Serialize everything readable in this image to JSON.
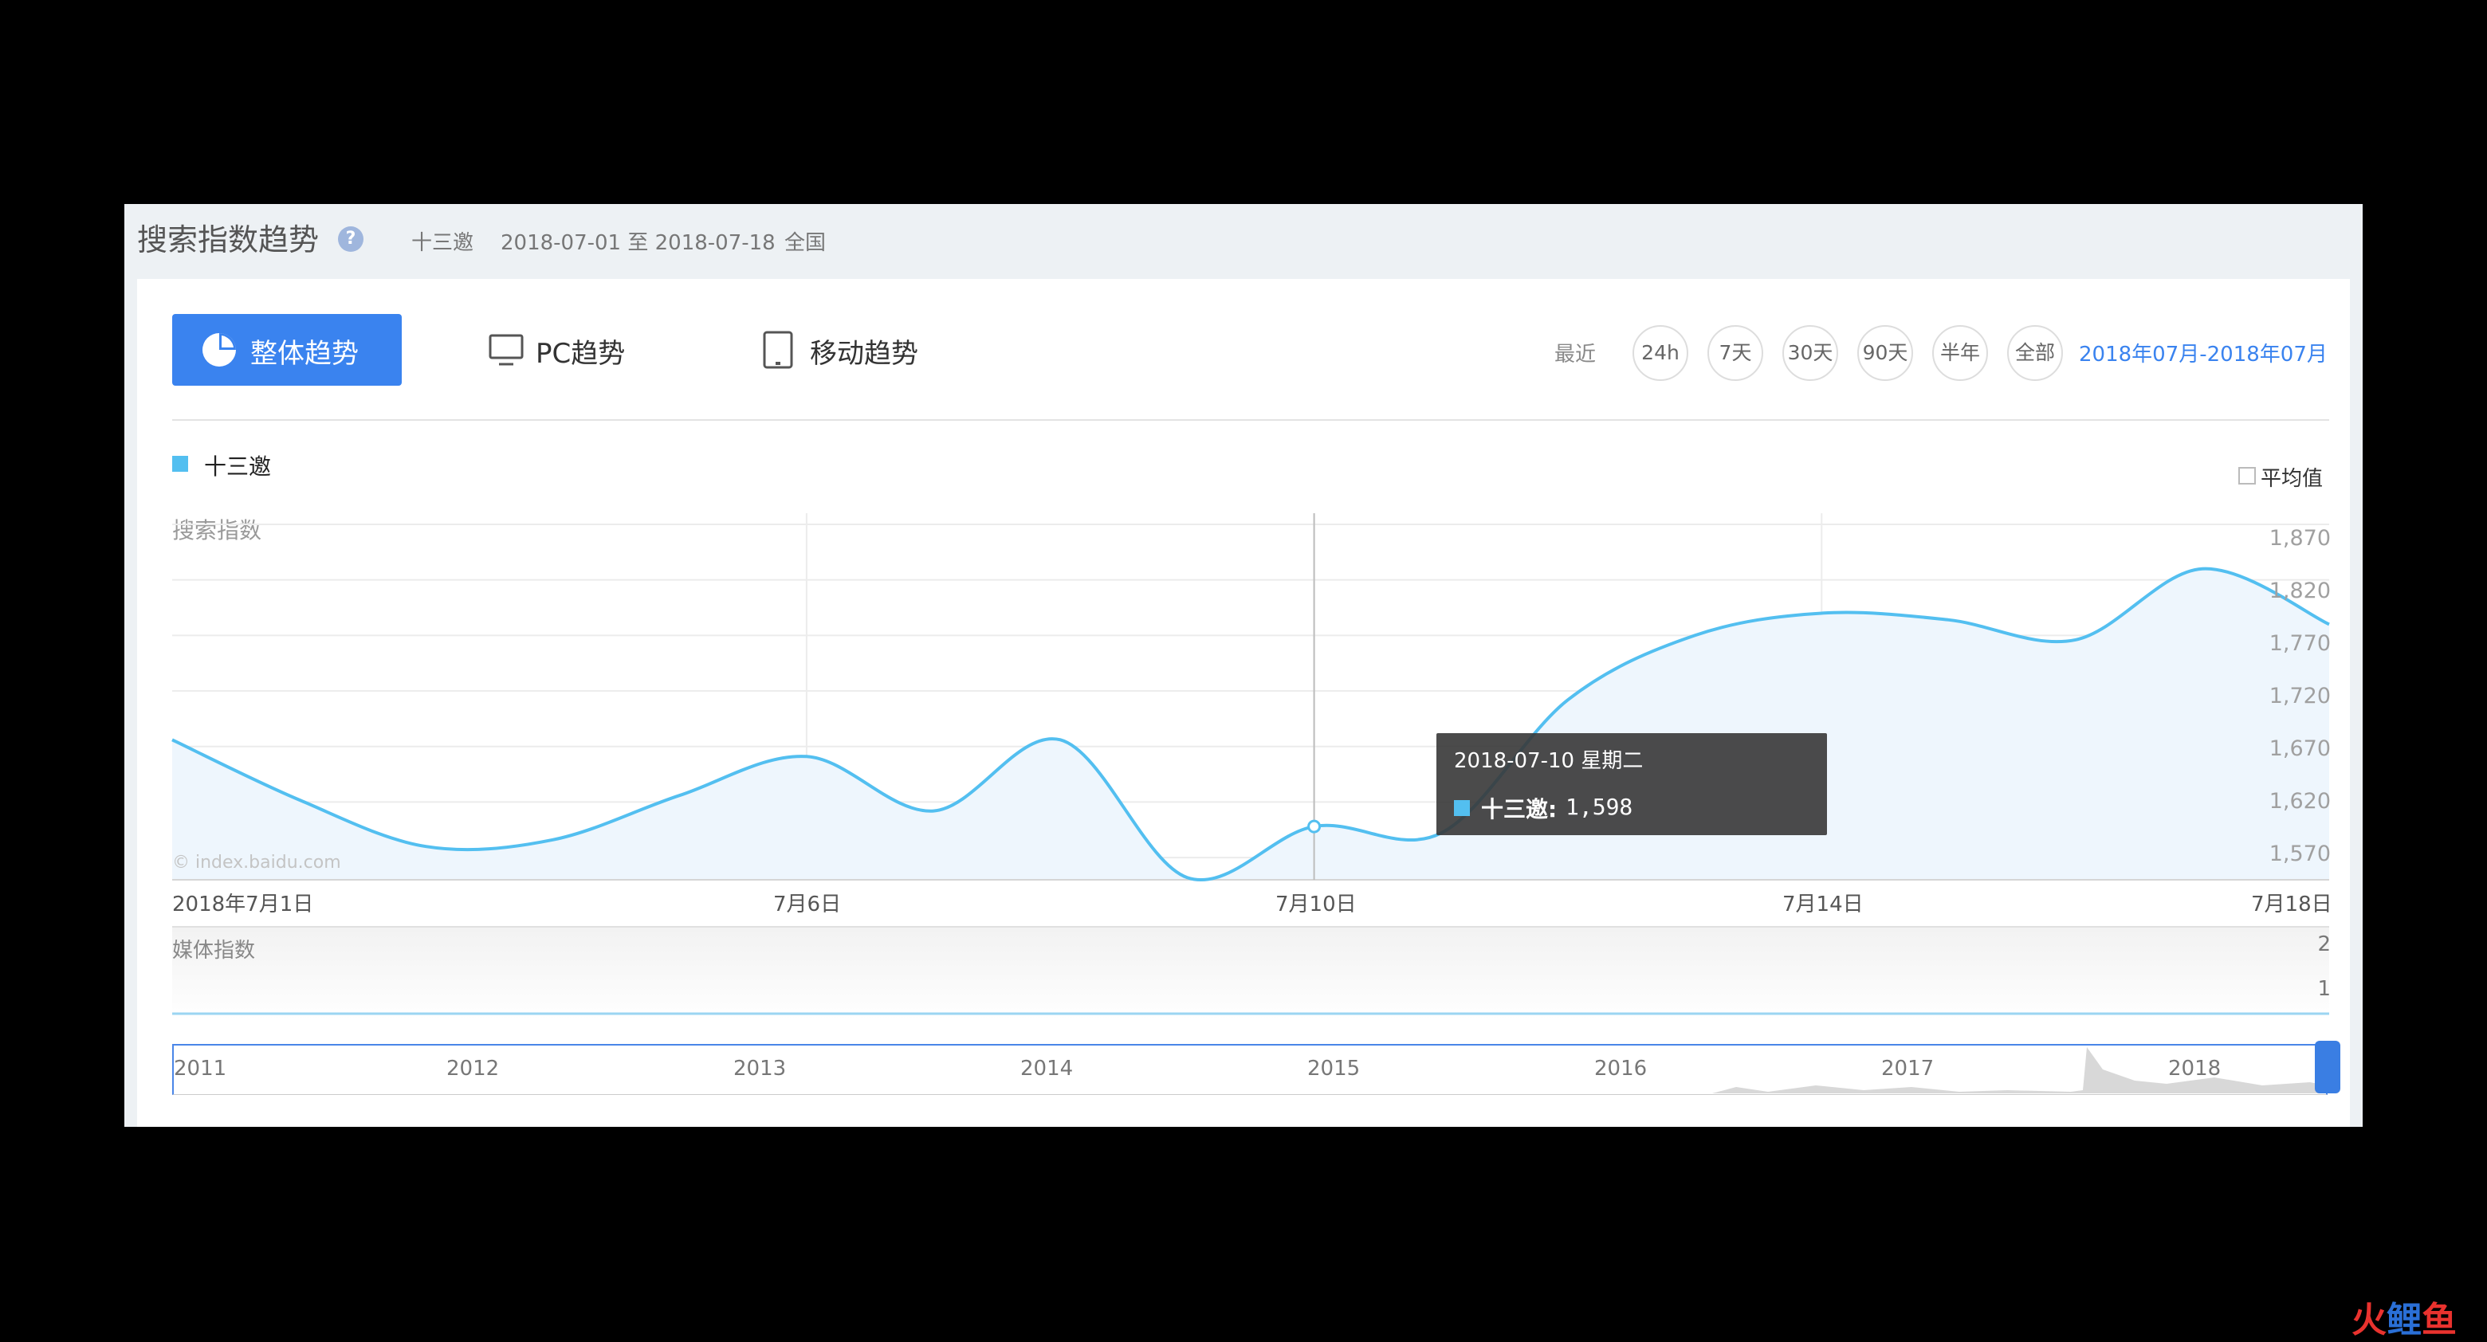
{
  "header": {
    "title": "搜索指数趋势",
    "help_icon": "?",
    "keyword": "十三邀",
    "date_range": "2018-07-01 至 2018-07-18",
    "region": "全国"
  },
  "tabs": {
    "overall": "整体趋势",
    "pc": "PC趋势",
    "mobile": "移动趋势"
  },
  "period": {
    "label": "最近",
    "options": [
      "24h",
      "7天",
      "30天",
      "90天",
      "半年",
      "全部"
    ],
    "custom_range": "2018年07月-2018年07月"
  },
  "legend": {
    "series_name": "十三邀",
    "average_label": "平均值"
  },
  "chart_data": {
    "type": "area",
    "title": "",
    "ylabel": "搜索指数",
    "y_ticks": [
      "1,870",
      "1,820",
      "1,770",
      "1,720",
      "1,670",
      "1,620",
      "1,570"
    ],
    "ylim": [
      1550,
      1880
    ],
    "x_tick_labels": [
      "2018年7月1日",
      "7月6日",
      "7月10日",
      "7月14日",
      "7月18日"
    ],
    "x": [
      "2018-07-01",
      "2018-07-02",
      "2018-07-03",
      "2018-07-04",
      "2018-07-05",
      "2018-07-06",
      "2018-07-07",
      "2018-07-08",
      "2018-07-09",
      "2018-07-10",
      "2018-07-11",
      "2018-07-12",
      "2018-07-13",
      "2018-07-14",
      "2018-07-15",
      "2018-07-16",
      "2018-07-17",
      "2018-07-18"
    ],
    "series": [
      {
        "name": "十三邀",
        "values": [
          1676,
          1622,
          1580,
          1586,
          1626,
          1661,
          1612,
          1676,
          1552,
          1598,
          1592,
          1712,
          1770,
          1790,
          1784,
          1766,
          1830,
          1780
        ]
      }
    ],
    "watermark": "© index.baidu.com",
    "grid": true,
    "color": "#53bff0",
    "fill": "#eef6fd"
  },
  "tooltip": {
    "date": "2018-07-10 星期二",
    "series_label": "十三邀:",
    "value": "1,598"
  },
  "media": {
    "title": "媒体指数",
    "ticks": [
      "2",
      "1"
    ]
  },
  "timeline": {
    "years": [
      "2011",
      "2012",
      "2013",
      "2014",
      "2015",
      "2016",
      "2017",
      "2018"
    ]
  },
  "logo": {
    "text": [
      "火",
      "鲤",
      "鱼"
    ],
    "colors": [
      "#e9322e",
      "#2a6fd6",
      "#e9322e"
    ]
  }
}
